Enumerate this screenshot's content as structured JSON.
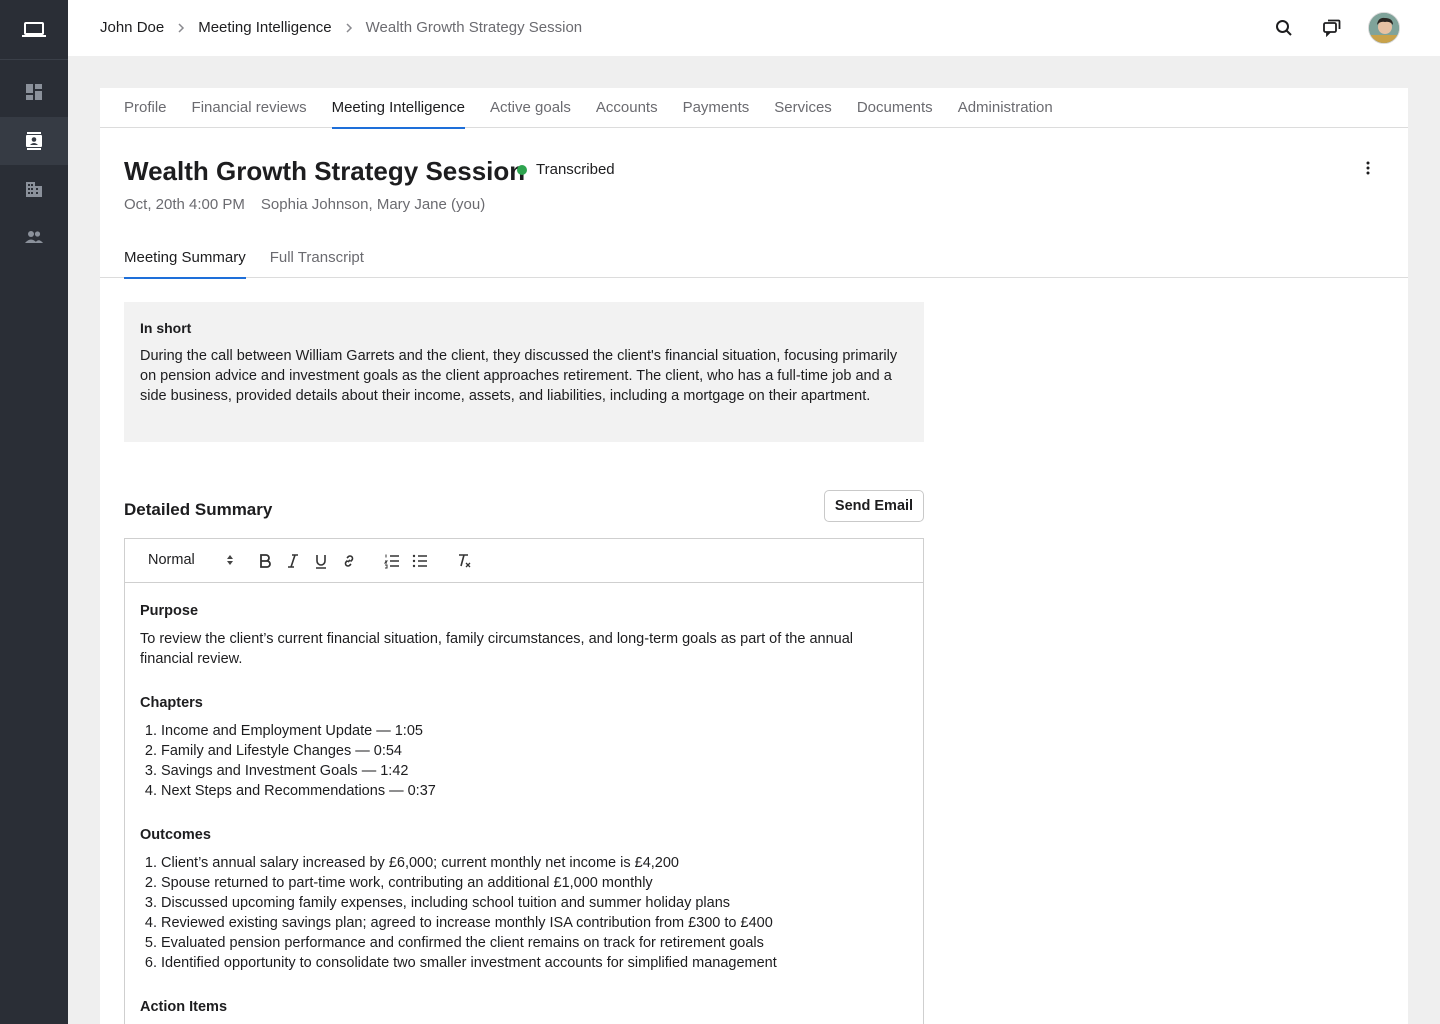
{
  "breadcrumb": [
    "John Doe",
    "Meeting Intelligence",
    "Wealth Growth Strategy Session"
  ],
  "tabs": [
    "Profile",
    "Financial reviews",
    "Meeting Intelligence",
    "Active goals",
    "Accounts",
    "Payments",
    "Services",
    "Documents",
    "Administration"
  ],
  "active_tab": "Meeting Intelligence",
  "meeting": {
    "title": "Wealth Growth Strategy Session",
    "status": "Transcribed",
    "status_color": "#2ea44f",
    "date": "Oct, 20th 4:00 PM",
    "participants": "Sophia Johnson, Mary Jane (you)"
  },
  "subtabs": [
    "Meeting Summary",
    "Full Transcript"
  ],
  "in_short": {
    "heading": "In short",
    "text": "During the call between William Garrets and the client, they discussed the client's financial situation, focusing primarily on pension advice and investment goals as the client approaches retirement. The client, who has a full-time job and a side business, provided details about their income, assets, and liabilities, including a mortgage on their apartment."
  },
  "detailed": {
    "title": "Detailed Summary",
    "send_label": "Send Email",
    "format": "Normal",
    "purpose_heading": "Purpose",
    "purpose_text": "To review the client’s current financial situation, family circumstances, and long-term goals as part of the annual financial review.",
    "chapters_heading": "Chapters",
    "chapters": [
      "Income and Employment Update — 1:05",
      "Family and Lifestyle Changes — 0:54",
      "Savings and Investment Goals — 1:42",
      "Next Steps and Recommendations — 0:37"
    ],
    "outcomes_heading": "Outcomes",
    "outcomes": [
      "Client’s annual salary increased by £6,000; current monthly net income is £4,200",
      "Spouse returned to part-time work, contributing an additional £1,000 monthly",
      "Discussed upcoming family expenses, including school tuition and summer holiday plans",
      "Reviewed existing savings plan; agreed to increase monthly ISA contribution from £300 to £400",
      "Evaluated pension performance and confirmed the client remains on track for retirement goals",
      "Identified opportunity to consolidate two smaller investment accounts for simplified management"
    ],
    "actions_heading": "Action Items"
  },
  "accent_color": "#1e6fd9"
}
